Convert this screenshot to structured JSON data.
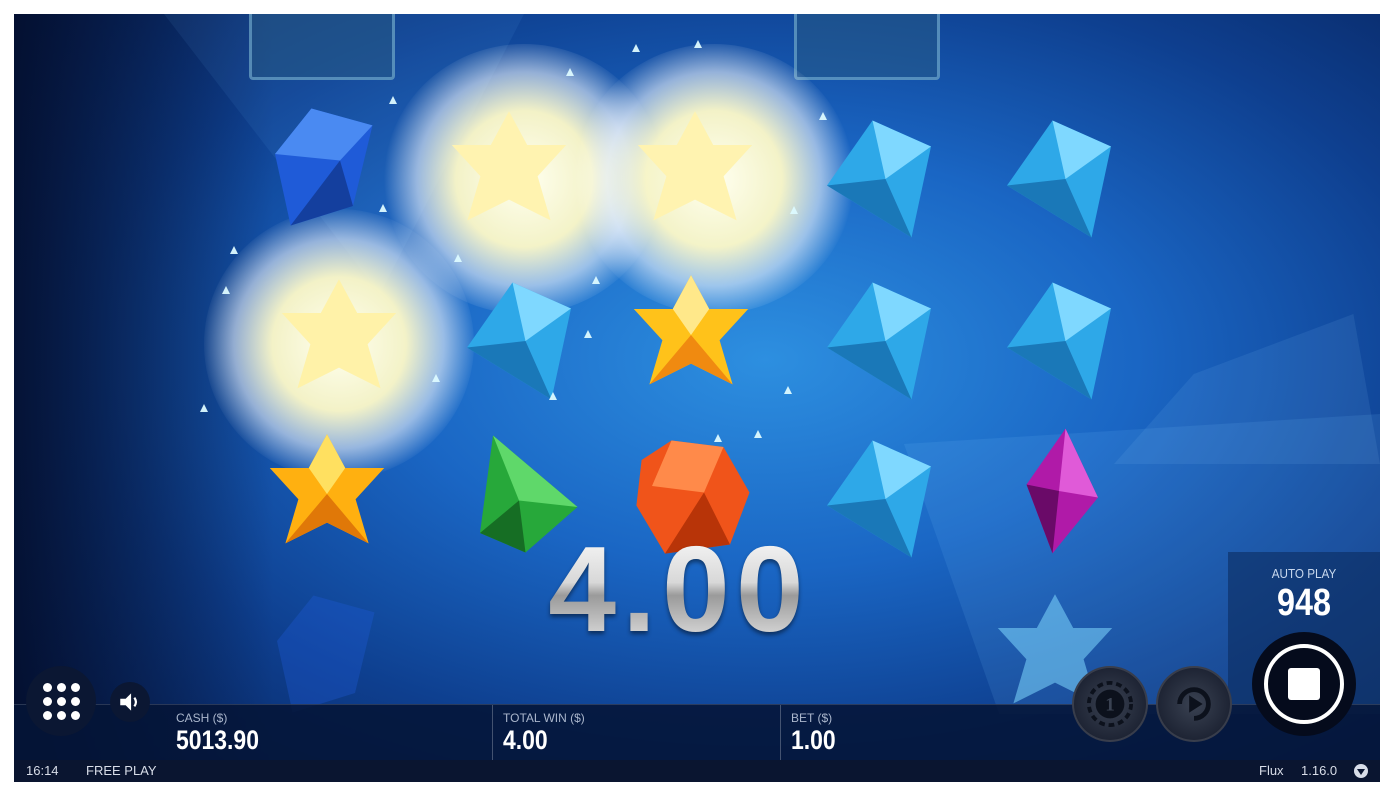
{
  "win": {
    "amount": "4.00"
  },
  "autoplay": {
    "label": "AUTO PLAY",
    "count": "948"
  },
  "stats": {
    "cash_label": "CASH ($)",
    "cash_value": "5013.90",
    "total_win_label": "TOTAL WIN ($)",
    "total_win_value": "4.00",
    "bet_label": "BET ($)",
    "bet_value": "1.00"
  },
  "status": {
    "time": "16:14",
    "mode": "FREE PLAY",
    "game_name": "Flux",
    "version": "1.16.0"
  },
  "colors": {
    "background": "#1a66c4",
    "bar": "#0a1530",
    "gem_blue": "#2ea8e8",
    "gem_yellow": "#ffc21a",
    "gem_green": "#27a83a",
    "gem_red": "#f0541a",
    "gem_purple": "#b01aa8",
    "gem_dark_blue": "#1f5bd8"
  },
  "icons": {
    "menu": "grid-menu-icon",
    "sound": "speaker-icon",
    "coin": "coin-value-icon",
    "autoplay": "autoplay-icon",
    "stop": "stop-icon",
    "info": "info-icon"
  }
}
